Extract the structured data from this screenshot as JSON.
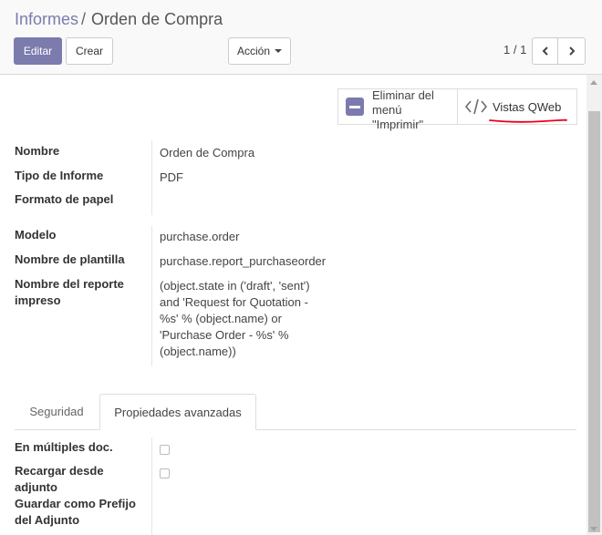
{
  "breadcrumb": {
    "parent": "Informes",
    "separator": "/",
    "current": "Orden de Compra"
  },
  "toolbar": {
    "edit_label": "Editar",
    "create_label": "Crear",
    "action_label": "Acción"
  },
  "pager": {
    "value": "1 / 1"
  },
  "button_box": {
    "unlink_label": "Eliminar del\nmenú\n\"Imprimir\"",
    "qweb_label": "Vistas QWeb",
    "accent_color": "#7c7bad",
    "annotation_color": "#e8001c"
  },
  "fields": {
    "name": {
      "label": "Nombre",
      "value": "Orden de Compra"
    },
    "report_type": {
      "label": "Tipo de Informe",
      "value": "PDF"
    },
    "paperformat": {
      "label": "Formato de papel",
      "value": ""
    },
    "model": {
      "label": "Modelo",
      "value": "purchase.order"
    },
    "report_name": {
      "label": "Nombre de plantilla",
      "value": "purchase.report_purchaseorder"
    },
    "print_report_name": {
      "label": "Nombre del reporte\nimpreso",
      "value": "(object.state in ('draft', 'sent')\nand 'Request for Quotation -\n%s' % (object.name) or\n'Purchase Order - %s' %\n(object.name))"
    }
  },
  "tabs": [
    {
      "label": "Seguridad",
      "active": false
    },
    {
      "label": "Propiedades avanzadas",
      "active": true
    }
  ],
  "advanced": {
    "multi": {
      "label": "En múltiples doc.",
      "checked": false
    },
    "attachment_use": {
      "label": "Recargar desde\nadjunto",
      "checked": false
    },
    "attachment": {
      "label": "Guardar como Prefijo\ndel Adjunto",
      "value": ""
    }
  }
}
